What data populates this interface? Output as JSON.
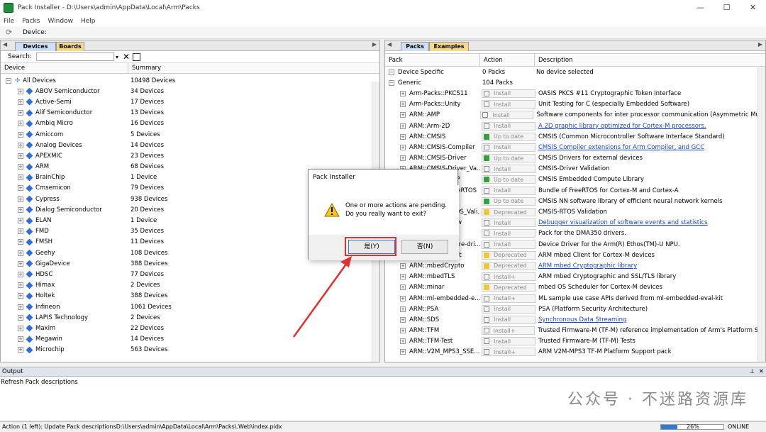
{
  "window": {
    "title": "Pack Installer - D:\\Users\\admin\\AppData\\Local\\Arm\\Packs",
    "min": "—",
    "max": "☐",
    "close": "✕"
  },
  "menu": [
    "File",
    "Packs",
    "Window",
    "Help"
  ],
  "toolbar": {
    "device_label": "Device:"
  },
  "left": {
    "tabs": [
      "Devices",
      "Boards"
    ],
    "search_label": "Search:",
    "col_device": "Device",
    "col_summary": "Summary",
    "root": {
      "name": "All Devices",
      "summary": "10498 Devices"
    },
    "items": [
      {
        "name": "ABOV Semiconductor",
        "summary": "34 Devices"
      },
      {
        "name": "Active-Semi",
        "summary": "17 Devices"
      },
      {
        "name": "Alif Semiconductor",
        "summary": "13 Devices"
      },
      {
        "name": "Ambiq Micro",
        "summary": "16 Devices"
      },
      {
        "name": "Amiccom",
        "summary": "5 Devices"
      },
      {
        "name": "Analog Devices",
        "summary": "14 Devices"
      },
      {
        "name": "APEXMIC",
        "summary": "23 Devices"
      },
      {
        "name": "ARM",
        "summary": "68 Devices"
      },
      {
        "name": "BrainChip",
        "summary": "1 Device"
      },
      {
        "name": "Cmsemicon",
        "summary": "79 Devices"
      },
      {
        "name": "Cypress",
        "summary": "938 Devices"
      },
      {
        "name": "Dialog Semiconductor",
        "summary": "20 Devices"
      },
      {
        "name": "ELAN",
        "summary": "1 Device"
      },
      {
        "name": "FMD",
        "summary": "35 Devices"
      },
      {
        "name": "FMSH",
        "summary": "11 Devices"
      },
      {
        "name": "Geehy",
        "summary": "108 Devices"
      },
      {
        "name": "GigaDevice",
        "summary": "388 Devices"
      },
      {
        "name": "HDSC",
        "summary": "77 Devices"
      },
      {
        "name": "Himax",
        "summary": "2 Devices"
      },
      {
        "name": "Holtek",
        "summary": "388 Devices"
      },
      {
        "name": "Infineon",
        "summary": "1061 Devices"
      },
      {
        "name": "LAPIS Technology",
        "summary": "2 Devices"
      },
      {
        "name": "Maxim",
        "summary": "22 Devices"
      },
      {
        "name": "Megawin",
        "summary": "14 Devices"
      },
      {
        "name": "Microchip",
        "summary": "563 Devices"
      }
    ]
  },
  "right": {
    "tabs": [
      "Packs",
      "Examples"
    ],
    "col_pack": "Pack",
    "col_action": "Action",
    "col_desc": "Description",
    "groups": [
      {
        "name": "Device Specific",
        "action": "0 Packs",
        "desc": "No device selected"
      },
      {
        "name": "Generic",
        "action": "104 Packs",
        "desc": ""
      }
    ],
    "packs": [
      {
        "name": "Arm-Packs::PKCS11",
        "action": "Install",
        "kind": "ins",
        "desc": "OASIS PKCS #11 Cryptographic Token Interface",
        "link": false
      },
      {
        "name": "Arm-Packs::Unity",
        "action": "Install",
        "kind": "ins",
        "desc": "Unit Testing for C (especially Embedded Software)",
        "link": false
      },
      {
        "name": "ARM::AMP",
        "action": "Install",
        "kind": "ins",
        "desc": "Software components for inter processor communication (Asymmetric Multi",
        "link": false
      },
      {
        "name": "ARM::Arm-2D",
        "action": "Install",
        "kind": "ins",
        "desc": "A 2D graphic library optimized for Cortex-M processors.",
        "link": true
      },
      {
        "name": "ARM::CMSIS",
        "action": "Up to date",
        "kind": "upd",
        "desc": "CMSIS (Common Microcontroller Software Interface Standard)",
        "link": false
      },
      {
        "name": "ARM::CMSIS-Compiler",
        "action": "Install",
        "kind": "ins",
        "desc": "CMSIS Compiler extensions for Arm Compiler, and GCC",
        "link": true
      },
      {
        "name": "ARM::CMSIS-Driver",
        "action": "Up to date",
        "kind": "upd",
        "desc": "CMSIS Drivers for external devices",
        "link": false
      },
      {
        "name": "ARM::CMSIS-Driver_Va...",
        "action": "Install",
        "kind": "ins",
        "desc": "CMSIS-Driver Validation",
        "link": false
      },
      {
        "name": "ARM::CMSIS-DSP",
        "action": "Up to date",
        "kind": "upd",
        "desc": "CMSIS Embedded Compute Library",
        "link": false
      },
      {
        "name": "ARM::CMSIS-FreeRTOS",
        "action": "Install",
        "kind": "ins",
        "desc": "Bundle of FreeRTOS for Cortex-M and Cortex-A",
        "link": false
      },
      {
        "name": "ARM::CMSIS-NN",
        "action": "Up to date",
        "kind": "upd",
        "desc": "CMSIS NN software library of efficient neural network kernels",
        "link": false
      },
      {
        "name": "ARM::CMSIS-RTOS_Vali...",
        "action": "Deprecated",
        "kind": "dep",
        "desc": "CMSIS-RTOS Validation",
        "link": false
      },
      {
        "name": "ARM::CMSIS-View",
        "action": "Install",
        "kind": "ins",
        "desc": "Debugger visualization of software events and statistics",
        "link": true
      },
      {
        "name": "ARM::DMA350",
        "action": "Install",
        "kind": "ins",
        "desc": "Pack for the DMA350 drivers.",
        "link": false
      },
      {
        "name": "ARM::ethos-u-core-dri...",
        "action": "Install",
        "kind": "ins",
        "desc": "Device Driver for the Arm(R) Ethos(TM)-U NPU.",
        "link": false
      },
      {
        "name": "ARM::mbedClient",
        "action": "Deprecated",
        "kind": "dep",
        "desc": "ARM mbed Client for Cortex-M devices",
        "link": false
      },
      {
        "name": "ARM::mbedCrypto",
        "action": "Deprecated",
        "kind": "dep",
        "desc": "ARM mbed Cryptographic library",
        "link": true
      },
      {
        "name": "ARM::mbedTLS",
        "action": "Install+",
        "kind": "ins",
        "desc": "ARM mbed Cryptographic and SSL/TLS library",
        "link": false
      },
      {
        "name": "ARM::minar",
        "action": "Deprecated",
        "kind": "dep",
        "desc": "mbed OS Scheduler for Cortex-M devices",
        "link": false
      },
      {
        "name": "ARM::ml-embedded-e...",
        "action": "Install+",
        "kind": "ins",
        "desc": "ML sample use case APIs derived from ml-embedded-eval-kit",
        "link": false
      },
      {
        "name": "ARM::PSA",
        "action": "Install",
        "kind": "ins",
        "desc": "PSA (Platform Security Architecture)",
        "link": false
      },
      {
        "name": "ARM::SDS",
        "action": "Install",
        "kind": "ins",
        "desc": "Synchronous Data Streaming",
        "link": true
      },
      {
        "name": "ARM::TFM",
        "action": "Install+",
        "kind": "ins",
        "desc": "Trusted Firmware-M (TF-M) reference implementation of Arm's Platform Sec",
        "link": false
      },
      {
        "name": "ARM::TFM-Test",
        "action": "Install",
        "kind": "ins",
        "desc": "Trusted Firmware-M (TF-M) Tests",
        "link": false
      },
      {
        "name": "ARM::V2M_MPS3_SSE...",
        "action": "Install+",
        "kind": "ins",
        "desc": "ARM V2M-MPS3 TF-M Platform Support pack",
        "link": false
      }
    ]
  },
  "output": {
    "header": "Output",
    "line": "Refresh Pack descriptions"
  },
  "status": {
    "text": "Action (1 left): Update Pack descriptionsD:\\Users\\admin\\AppData\\Local\\Arm\\Packs\\.Web\\index.pidx",
    "progress": 0.26,
    "progress_label": "26%",
    "mode": "ONLINE"
  },
  "dialog": {
    "title": "Pack Installer",
    "line1": "One or more actions are pending.",
    "line2": "Do you really want to exit?",
    "yes": "是(Y)",
    "no": "否(N)"
  },
  "watermark": {
    "text": "公众号 · 不迷路资源库"
  },
  "colors": {
    "accent": "#2f7ad4",
    "highlight": "#e03030",
    "tab_active": "#cfe0f6",
    "tab_inactive": "#f6d98a"
  }
}
